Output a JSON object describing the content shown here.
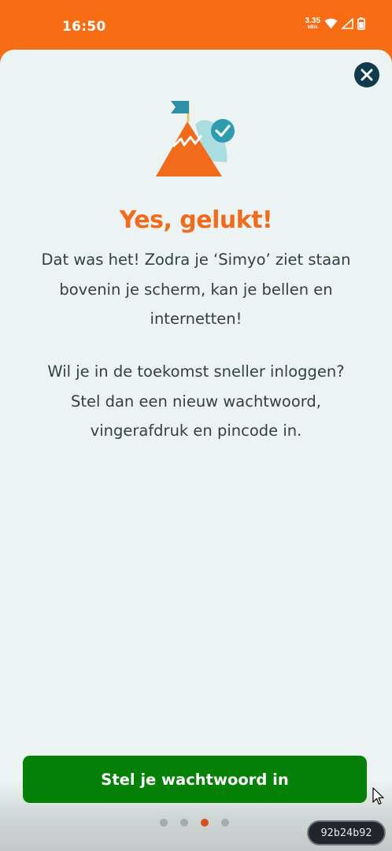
{
  "status_bar": {
    "time": "16:50",
    "net_speed_value": "3.35",
    "net_speed_unit": "kB/s",
    "icons": [
      "wifi-icon",
      "signal-icon",
      "battery-icon"
    ]
  },
  "colors": {
    "brand_orange": "#f86c14",
    "title_orange": "#f26a1b",
    "button_green": "#068108",
    "close_navy": "#0f3b4c",
    "active_dot": "#d5531a"
  },
  "sheet": {
    "close_icon": "close-icon",
    "illustration": "mountain-flag-check-illustration",
    "title": "Yes, gelukt!",
    "paragraph1_lines": [
      "Dat was het! Zodra je ‘Simyo’ ziet staan",
      "bovenin je scherm, kan je bellen en",
      "internetten!"
    ],
    "paragraph2_lines": [
      "Wil je in de toekomst sneller inloggen?",
      "Stel dan een nieuw wachtwoord,",
      "vingerafdruk en pincode in."
    ],
    "button_label": "Stel je wachtwoord in",
    "pager": {
      "count": 4,
      "active_index": 2
    }
  },
  "overlay": {
    "session_id": "92b24b92"
  }
}
